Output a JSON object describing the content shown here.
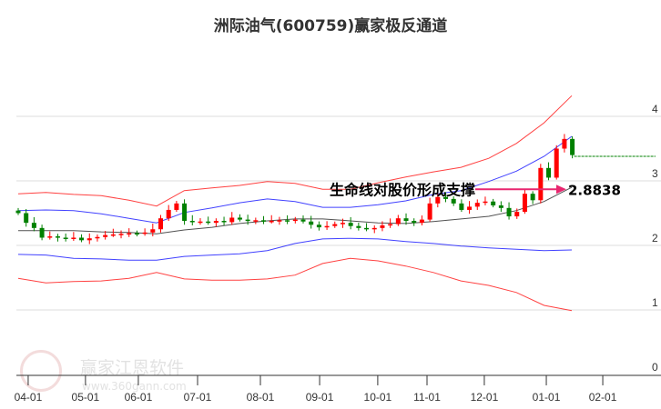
{
  "chart_data": {
    "type": "candlestick",
    "title": "洲际油气(600759)赢家极反通道",
    "ylim": [
      0,
      4.4
    ],
    "y_ticks": [
      0,
      1,
      2,
      3,
      4
    ],
    "x_ticks": [
      {
        "label": "04-01",
        "t": 3.6
      },
      {
        "label": "05-01",
        "t": 24.3
      },
      {
        "label": "06-01",
        "t": 43.4
      },
      {
        "label": "07-01",
        "t": 64.8
      },
      {
        "label": "08-01",
        "t": 87.5
      },
      {
        "label": "09-01",
        "t": 108.9
      },
      {
        "label": "10-01",
        "t": 129.9
      },
      {
        "label": "11-01",
        "t": 147.7
      },
      {
        "label": "12-01",
        "t": 168.4
      },
      {
        "label": "01-01",
        "t": 190.8
      },
      {
        "label": "02-01",
        "t": 211.2
      }
    ],
    "x_range": [
      0,
      231
    ],
    "grid": true,
    "candle_step_days": 2.86,
    "closes": [
      2.5,
      2.35,
      2.27,
      2.12,
      2.14,
      2.12,
      2.11,
      2.12,
      2.08,
      2.11,
      2.13,
      2.16,
      2.17,
      2.18,
      2.19,
      2.18,
      2.2,
      2.25,
      2.42,
      2.55,
      2.65,
      2.38,
      2.36,
      2.37,
      2.35,
      2.38,
      2.36,
      2.43,
      2.4,
      2.38,
      2.39,
      2.37,
      2.38,
      2.39,
      2.38,
      2.4,
      2.37,
      2.32,
      2.28,
      2.3,
      2.33,
      2.35,
      2.3,
      2.27,
      2.25,
      2.27,
      2.31,
      2.33,
      2.42,
      2.38,
      2.35,
      2.4,
      2.65,
      2.75,
      2.72,
      2.65,
      2.55,
      2.6,
      2.66,
      2.68,
      2.62,
      2.58,
      2.45,
      2.52,
      2.8,
      2.7,
      3.2,
      3.05,
      3.5,
      3.65,
      3.4
    ],
    "lines_step_days": 10,
    "series": [
      {
        "name": "upper-outer",
        "color": "#ff2020",
        "values": [
          2.8,
          2.82,
          2.79,
          2.77,
          2.7,
          2.61,
          2.85,
          2.89,
          2.93,
          2.99,
          2.96,
          2.87,
          2.87,
          2.97,
          3.06,
          3.14,
          3.21,
          3.35,
          3.58,
          3.9,
          4.32
        ]
      },
      {
        "name": "upper-inner",
        "color": "#2020ff",
        "values": [
          2.54,
          2.55,
          2.54,
          2.49,
          2.42,
          2.35,
          2.51,
          2.58,
          2.66,
          2.72,
          2.68,
          2.59,
          2.59,
          2.63,
          2.69,
          2.79,
          2.85,
          2.99,
          3.15,
          3.38,
          3.69
        ]
      },
      {
        "name": "life-line",
        "color": "#333333",
        "values": [
          2.23,
          2.23,
          2.23,
          2.21,
          2.2,
          2.18,
          2.24,
          2.28,
          2.34,
          2.38,
          2.41,
          2.41,
          2.38,
          2.35,
          2.34,
          2.37,
          2.41,
          2.45,
          2.54,
          2.68,
          2.9
        ]
      },
      {
        "name": "lower-inner",
        "color": "#2020ff",
        "values": [
          1.86,
          1.85,
          1.8,
          1.79,
          1.77,
          1.77,
          1.83,
          1.85,
          1.87,
          1.92,
          2.03,
          2.1,
          2.11,
          2.1,
          2.06,
          2.03,
          1.99,
          1.96,
          1.94,
          1.92,
          1.93
        ]
      },
      {
        "name": "lower-outer",
        "color": "#ff2020",
        "values": [
          1.49,
          1.42,
          1.44,
          1.45,
          1.49,
          1.58,
          1.48,
          1.46,
          1.46,
          1.48,
          1.54,
          1.72,
          1.8,
          1.76,
          1.68,
          1.58,
          1.45,
          1.38,
          1.27,
          1.07,
          0.99
        ]
      }
    ],
    "reference_level": 3.38,
    "annotation": {
      "text": "生命线对股价形成支撑",
      "value_label": "2.8838",
      "value": 2.8838
    },
    "colors": {
      "up": "#ff0000",
      "down": "#008000",
      "arrow": "#e8266f",
      "grid": "#dddddd"
    }
  },
  "watermark": {
    "brand": "赢家江恩软件",
    "url": "www.360gann.com",
    "logo_text": "江赢恩家"
  }
}
